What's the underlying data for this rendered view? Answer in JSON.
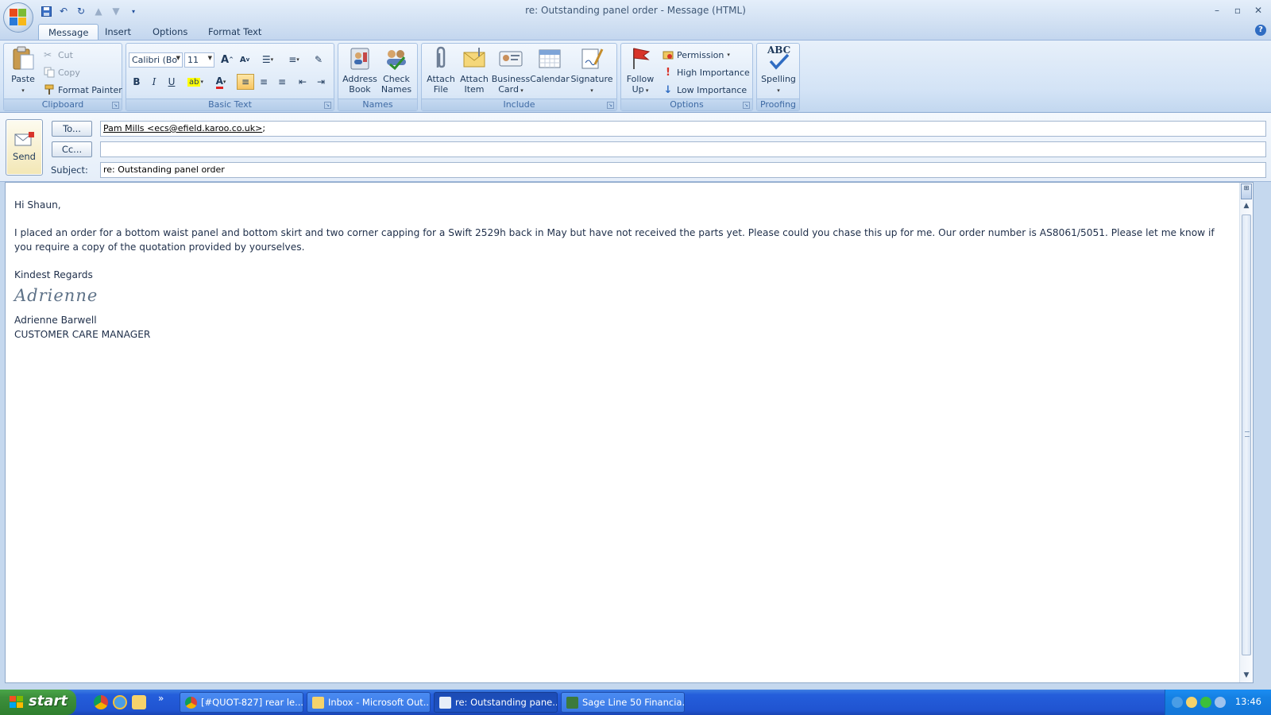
{
  "window": {
    "title": "re: Outstanding panel order - Message (HTML)"
  },
  "tabs": [
    {
      "label": "Message",
      "active": true
    },
    {
      "label": "Insert"
    },
    {
      "label": "Options"
    },
    {
      "label": "Format Text"
    }
  ],
  "ribbon": {
    "clipboard": {
      "label": "Clipboard",
      "paste": "Paste",
      "cut": "Cut",
      "copy": "Copy",
      "format_painter": "Format Painter"
    },
    "basic_text": {
      "label": "Basic Text",
      "font": "Calibri (Bo",
      "size": "11"
    },
    "names": {
      "label": "Names",
      "address_book_1": "Address",
      "address_book_2": "Book",
      "check_names_1": "Check",
      "check_names_2": "Names"
    },
    "include": {
      "label": "Include",
      "attach_file_1": "Attach",
      "attach_file_2": "File",
      "attach_item_1": "Attach",
      "attach_item_2": "Item",
      "business_card_1": "Business",
      "business_card_2": "Card",
      "calendar": "Calendar",
      "signature": "Signature"
    },
    "options": {
      "label": "Options",
      "follow_up_1": "Follow",
      "follow_up_2": "Up",
      "permission": "Permission",
      "high_importance": "High Importance",
      "low_importance": "Low Importance"
    },
    "proofing": {
      "label": "Proofing",
      "spelling": "Spelling",
      "abc": "ABC"
    }
  },
  "header": {
    "send": "Send",
    "to_button": "To...",
    "cc_button": "Cc...",
    "subject_label": "Subject:",
    "to_value": "Pam Mills <ecs@efield.karoo.co.uk>",
    "to_separator": ";",
    "cc_value": "",
    "subject_value": "re: Outstanding panel order"
  },
  "message": {
    "greeting": "Hi Shaun,",
    "body": "I placed an order for a bottom waist panel and bottom skirt and two corner capping for a Swift 2529h back in May but have not received the parts yet.  Please could you chase this up for me.  Our order number is AS8061/5051.  Please let me know if you require a copy of the quotation provided by yourselves.",
    "closing": "Kindest Regards",
    "signature_script": "Adrienne",
    "sig_name": "Adrienne Barwell",
    "sig_title": "CUSTOMER CARE MANAGER"
  },
  "taskbar": {
    "start": "start",
    "items": [
      {
        "label": "[#QUOT-827] rear le...",
        "icon": "chrome-icon"
      },
      {
        "label": "Inbox - Microsoft Out...",
        "icon": "outlook-icon"
      },
      {
        "label": "re: Outstanding pane...",
        "icon": "message-icon",
        "active": true
      },
      {
        "label": "Sage Line 50 Financia...",
        "icon": "sage-icon"
      }
    ],
    "clock": "13:46"
  },
  "colors": {
    "ribbon_bg": "#d3e3f6",
    "taskbar_blue": "#245edb",
    "start_green": "#3d8f3c",
    "tray_blue": "#1581e4"
  }
}
